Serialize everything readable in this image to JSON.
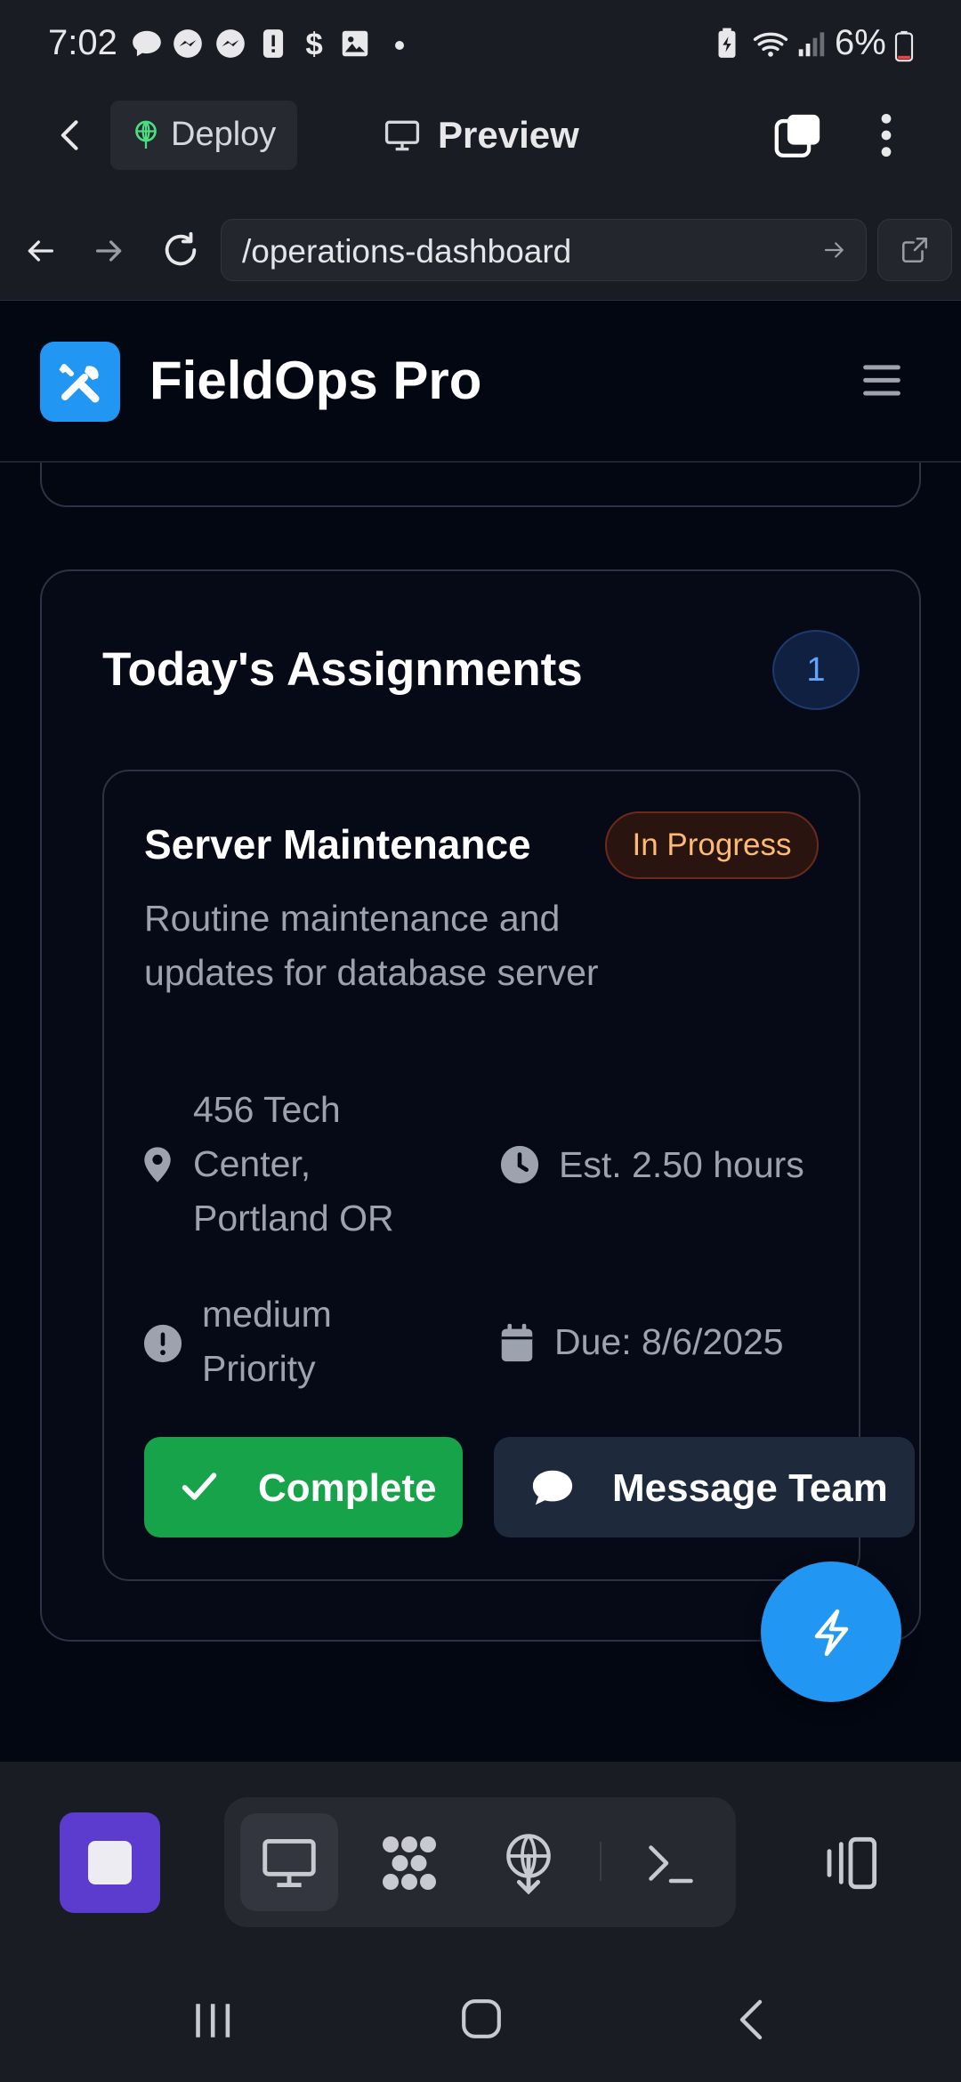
{
  "status_bar": {
    "time": "7:02",
    "battery_percent": "6%",
    "battery_level": 0.06,
    "icons": [
      "chat-bubble-icon",
      "messenger-icon",
      "messenger-icon",
      "alert-icon",
      "dollar-icon",
      "image-icon",
      "dot-icon",
      "battery-saver-icon",
      "wifi-icon",
      "signal-icon",
      "battery-icon"
    ]
  },
  "toolbar": {
    "deploy_label": "Deploy",
    "preview_label": "Preview"
  },
  "address_bar": {
    "url": "/operations-dashboard"
  },
  "app": {
    "name": "FieldOps Pro"
  },
  "assignments": {
    "title": "Today's Assignments",
    "count": "1",
    "tasks": [
      {
        "title": "Server Maintenance",
        "status": "In Progress",
        "description": "Routine maintenance and updates for database server",
        "location": "456 Tech Center, Portland OR",
        "estimate": "Est. 2.50 hours",
        "priority": "medium Priority",
        "due": "Due: 8/6/2025",
        "complete_label": "Complete",
        "message_label": "Message Team"
      }
    ]
  },
  "colors": {
    "accent": "#2196f3",
    "success": "#16a34a",
    "status_in_progress": "#fdba74",
    "background": "#030712",
    "stop_button": "#5b3ccf"
  }
}
